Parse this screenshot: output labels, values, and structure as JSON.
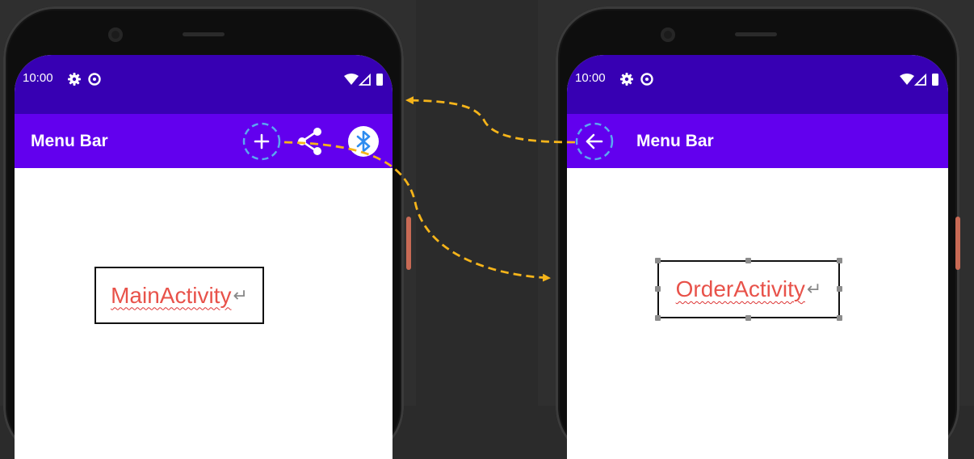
{
  "left_phone": {
    "status_time": "10:00",
    "appbar_title": "Menu Bar",
    "activity_label": "MainActivity",
    "actions": [
      "add-icon",
      "share-icon",
      "bluetooth-icon"
    ]
  },
  "right_phone": {
    "status_time": "10:00",
    "appbar_title": "Menu Bar",
    "activity_label": "OrderActivity",
    "actions": [
      "back-arrow-icon"
    ]
  },
  "colors": {
    "status_bar": "#3700b3",
    "app_bar": "#6200ee",
    "highlight": "#5aa8f0",
    "arrow": "#f5b41a",
    "label_text": "#e8524a",
    "background": "#2b2b2b"
  }
}
